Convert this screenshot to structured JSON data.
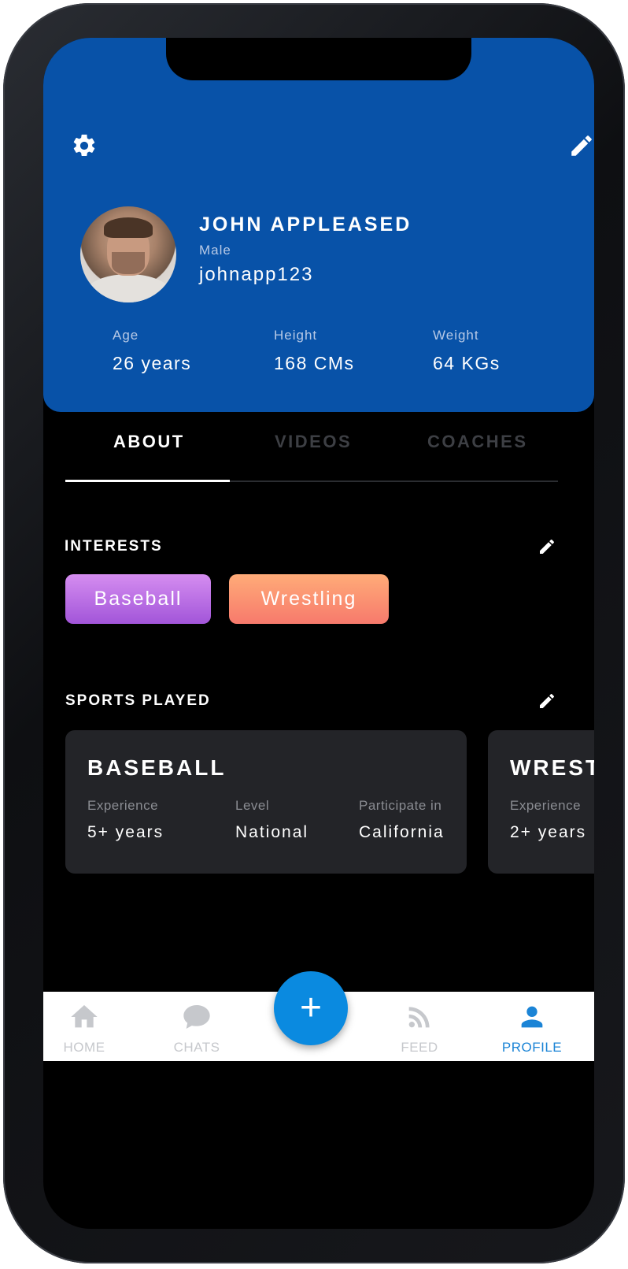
{
  "profile": {
    "name": "JOHN APPLEASED",
    "gender": "Male",
    "username": "johnapp123",
    "stats": [
      {
        "label": "Age",
        "value": "26 years"
      },
      {
        "label": "Height",
        "value": "168 CMs"
      },
      {
        "label": "Weight",
        "value": "64 KGs"
      }
    ]
  },
  "icons": {
    "settings": "gear-icon",
    "edit": "pencil-icon"
  },
  "tabs": [
    {
      "label": "ABOUT",
      "active": true
    },
    {
      "label": "VIDEOS",
      "active": false
    },
    {
      "label": "COACHES",
      "active": false
    }
  ],
  "interests": {
    "title": "INTERESTS",
    "items": [
      "Baseball",
      "Wrestling"
    ]
  },
  "sports": {
    "title": "SPORTS PLAYED",
    "cards": [
      {
        "title": "BASEBALL",
        "fields": [
          {
            "label": "Experience",
            "value": "5+ years"
          },
          {
            "label": "Level",
            "value": "National"
          },
          {
            "label": "Participate in",
            "value": "California"
          }
        ]
      },
      {
        "title": "WRESTLING",
        "fields": [
          {
            "label": "Experience",
            "value": "2+ years"
          }
        ]
      }
    ]
  },
  "nav": {
    "items": [
      {
        "label": "HOME",
        "icon": "home-icon"
      },
      {
        "label": "CHATS",
        "icon": "chat-icon"
      },
      {
        "label": "FEED",
        "icon": "rss-icon"
      },
      {
        "label": "PROFILE",
        "icon": "user-icon",
        "active": true
      }
    ],
    "fab": "+"
  },
  "colors": {
    "header": "#0852a8",
    "accent": "#0a8ae0",
    "active_nav": "#1b84d6",
    "chip_purple": "#a255d9",
    "chip_orange": "#f77a6c"
  }
}
